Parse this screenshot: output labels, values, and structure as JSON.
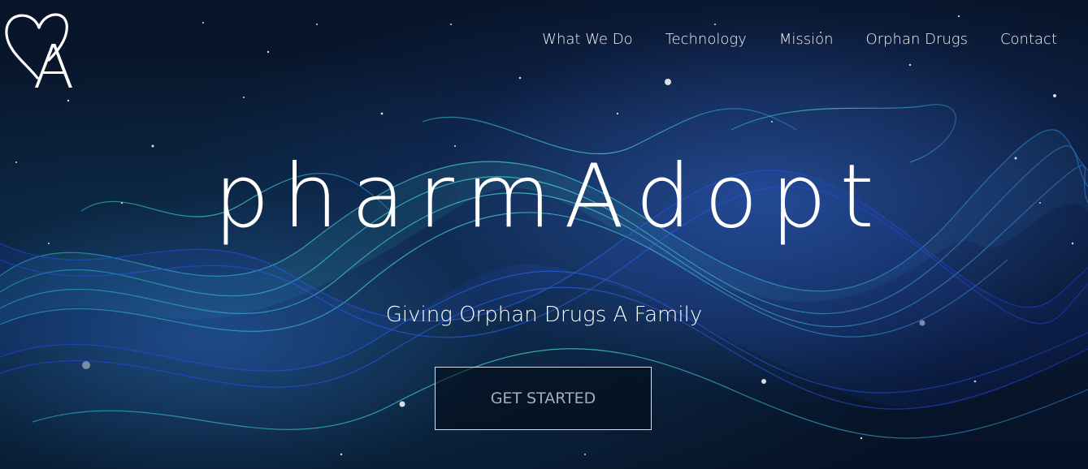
{
  "logo": {
    "icon": "heart-a-logo",
    "glyph": "A"
  },
  "nav": {
    "items": [
      {
        "label": "What We Do"
      },
      {
        "label": "Technology"
      },
      {
        "label": "Mission"
      },
      {
        "label": "Orphan Drugs"
      },
      {
        "label": "Contact"
      }
    ]
  },
  "hero": {
    "title": "pharmAdopt",
    "tagline": "Giving Orphan Drugs A Family",
    "cta_label": "GET STARTED"
  },
  "colors": {
    "background": "#071428",
    "text": "#ffffff",
    "cta_text": "#a6adba",
    "wave_teal": "#3fd0c8",
    "wave_blue": "#2a48d8"
  }
}
